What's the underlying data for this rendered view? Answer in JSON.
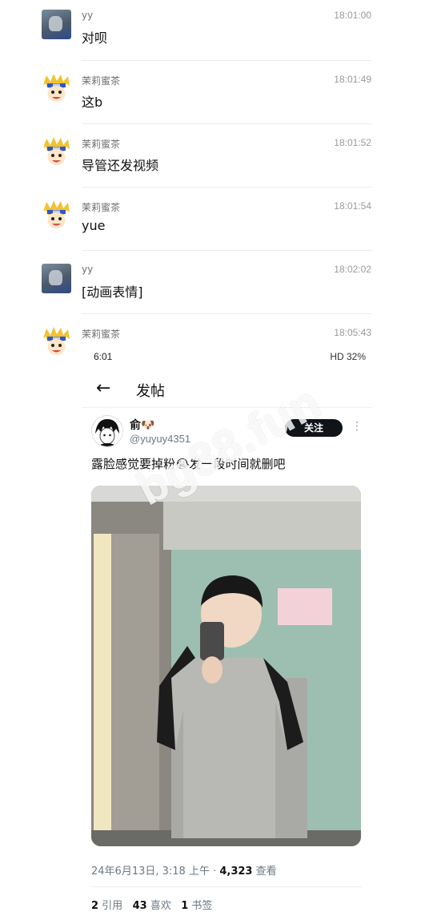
{
  "messages": [
    {
      "sender": "yy",
      "time": "18:01:00",
      "text": "对呗",
      "avatar": "yy"
    },
    {
      "sender": "茉莉蜜茶",
      "time": "18:01:49",
      "text": "这b",
      "avatar": "naruto"
    },
    {
      "sender": "茉莉蜜茶",
      "time": "18:01:52",
      "text": "导管还发视频",
      "avatar": "naruto"
    },
    {
      "sender": "茉莉蜜茶",
      "time": "18:01:54",
      "text": "yue",
      "avatar": "naruto"
    },
    {
      "sender": "yy",
      "time": "18:02:02",
      "text": "[动画表情]",
      "avatar": "yy"
    },
    {
      "sender": "茉莉蜜茶",
      "time": "18:05:43",
      "text": "",
      "avatar": "naruto"
    }
  ],
  "screenshot": {
    "status_time": "6:01",
    "status_right": "HD 32%",
    "back_icon": "arrow-left-icon",
    "title": "发帖",
    "post": {
      "name": "俞🐶",
      "handle": "@yuyuy4351",
      "follow_label": "关注",
      "text": "露脸感觉要掉粉😭发一段时间就删吧",
      "date": "24年6月13日, 3:18 上午 · ",
      "views": "4,323",
      "views_label": " 查看",
      "quotes": "2",
      "quotes_label": " 引用",
      "likes": "43",
      "likes_label": " 喜欢",
      "bookmarks": "1",
      "bookmarks_label": " 书签"
    },
    "watermark": "bg88.fun"
  },
  "colors": {
    "follow_bg": "#0f1419",
    "muted": "#6b7886",
    "sep": "#ececec"
  }
}
